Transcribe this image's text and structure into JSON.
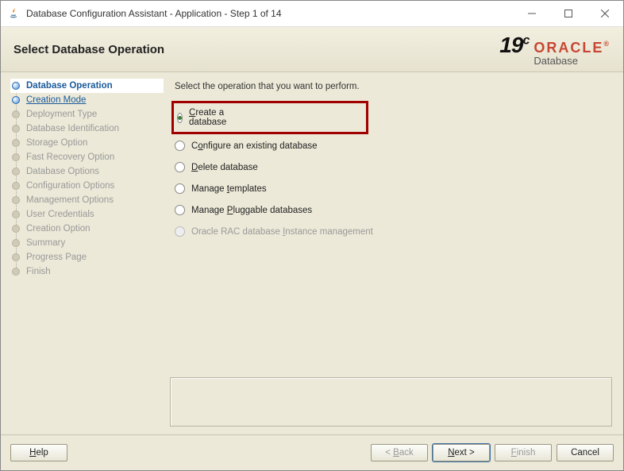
{
  "window": {
    "title": "Database Configuration Assistant - Application - Step 1 of 14"
  },
  "header": {
    "title": "Select Database Operation",
    "brand_version": "19",
    "brand_version_suffix": "c",
    "brand_name": "ORACLE",
    "brand_tm": "®",
    "brand_sub": "Database"
  },
  "sidebar": {
    "steps": [
      {
        "label": "Database Operation",
        "state": "active"
      },
      {
        "label": "Creation Mode",
        "state": "link"
      },
      {
        "label": "Deployment Type",
        "state": "future"
      },
      {
        "label": "Database Identification",
        "state": "future"
      },
      {
        "label": "Storage Option",
        "state": "future"
      },
      {
        "label": "Fast Recovery Option",
        "state": "future"
      },
      {
        "label": "Database Options",
        "state": "future"
      },
      {
        "label": "Configuration Options",
        "state": "future"
      },
      {
        "label": "Management Options",
        "state": "future"
      },
      {
        "label": "User Credentials",
        "state": "future"
      },
      {
        "label": "Creation Option",
        "state": "future"
      },
      {
        "label": "Summary",
        "state": "future"
      },
      {
        "label": "Progress Page",
        "state": "future"
      },
      {
        "label": "Finish",
        "state": "future"
      }
    ]
  },
  "main": {
    "prompt": "Select the operation that you want to perform.",
    "options": [
      {
        "pre": "",
        "accel": "C",
        "post": "reate a database",
        "selected": true,
        "highlighted": true,
        "enabled": true
      },
      {
        "pre": "C",
        "accel": "o",
        "post": "nfigure an existing database",
        "selected": false,
        "enabled": true
      },
      {
        "pre": "",
        "accel": "D",
        "post": "elete database",
        "selected": false,
        "enabled": true
      },
      {
        "pre": "Manage ",
        "accel": "t",
        "post": "emplates",
        "selected": false,
        "enabled": true
      },
      {
        "pre": "Manage ",
        "accel": "P",
        "post": "luggable databases",
        "selected": false,
        "enabled": true
      },
      {
        "pre": "Oracle RAC database ",
        "accel": "I",
        "post": "nstance management",
        "selected": false,
        "enabled": false
      }
    ]
  },
  "footer": {
    "help_pre": "",
    "help_accel": "H",
    "help_post": "elp",
    "back_pre": "< ",
    "back_accel": "B",
    "back_post": "ack",
    "next_pre": "",
    "next_accel": "N",
    "next_post": "ext >",
    "finish_pre": "",
    "finish_accel": "F",
    "finish_post": "inish",
    "cancel": "Cancel"
  }
}
